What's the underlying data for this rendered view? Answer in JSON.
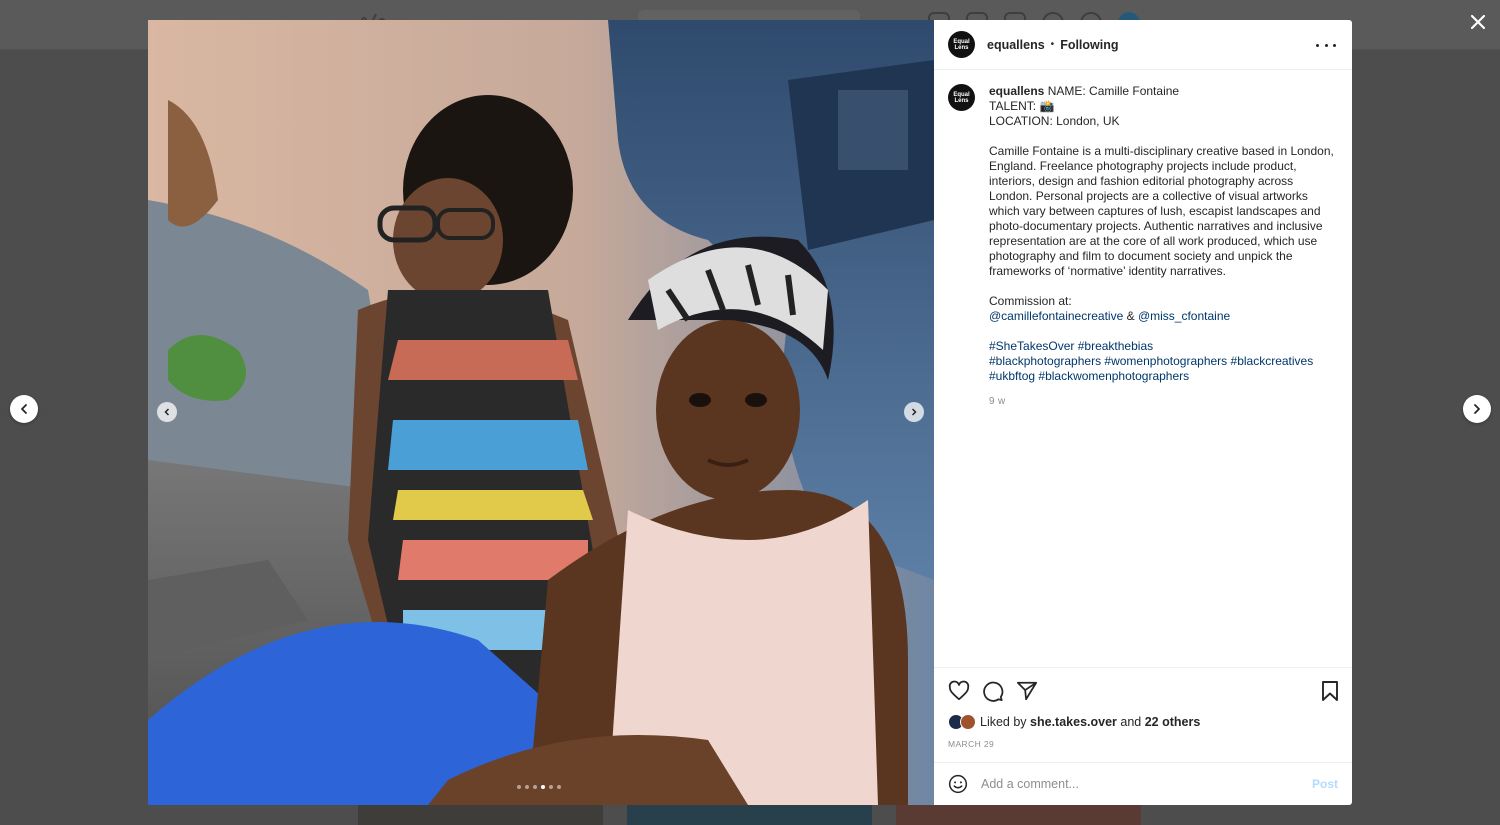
{
  "colors": {
    "link": "#00376b",
    "text": "#262626",
    "muted": "#8e8e8e",
    "post_disabled": "#b3dbff",
    "overlay": "#4d4d4d"
  },
  "post": {
    "header": {
      "avatar_text": "Equal Lens",
      "username": "equallens",
      "separator": "•",
      "follow_status": "Following",
      "more_icon": "more-horizontal-icon"
    },
    "caption": {
      "username": "equallens",
      "line1": "NAME: Camille Fontaine",
      "line2": "TALENT: 📸",
      "line3": "LOCATION: London, UK",
      "bio": "Camille Fontaine is a multi-disciplinary creative based in London, England. Freelance photography projects include product, interiors, design and fashion editorial photography across London. Personal projects are a collective of visual artworks which vary between captures of lush, escapist landscapes and photo-documentary projects. Authentic narratives and inclusive representation are at the core of all work produced, which use photography and film to document society and unpick the frameworks of ‘normative’ identity narratives.",
      "commission_label": "Commission at:",
      "mention1": "@camillefontainecreative",
      "ampersand": "&",
      "mention2": "@miss_cfontaine",
      "hashtags": [
        "#SheTakesOver",
        "#breakthebias",
        "#blackphotographers",
        "#womenphotographers",
        "#blackcreatives",
        "#ukbftog",
        "#blackwomenphotographers"
      ],
      "time_ago": "9 w"
    },
    "likes": {
      "prefix": "Liked by",
      "liker": "she.takes.over",
      "conjunction": "and",
      "others": "22 others"
    },
    "date": "MARCH 29",
    "comment": {
      "placeholder": "Add a comment...",
      "value": "",
      "post_label": "Post"
    },
    "carousel": {
      "total_slides": 6,
      "active_slide": 4
    }
  },
  "icons": {
    "close": "close-icon",
    "prev": "chevron-left-icon",
    "next": "chevron-right-icon",
    "like": "heart-icon",
    "comment": "comment-bubble-icon",
    "share": "paper-plane-icon",
    "save": "bookmark-icon",
    "emoji": "smiley-icon"
  }
}
